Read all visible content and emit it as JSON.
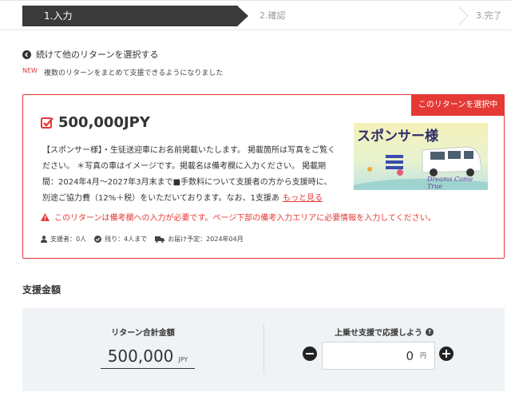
{
  "steps": {
    "step1": "1.入力",
    "step2": "2.確認",
    "step3": "3.完了"
  },
  "back_link": "続けて他のリターンを選択する",
  "notice": {
    "badge": "NEW",
    "text": "複数のリターンをまとめて支援できるようになりました"
  },
  "reward": {
    "selected_label": "このリターンを選択中",
    "price": "500,000JPY",
    "description": "【スポンサー様】・生徒送迎車にお名前掲載いたします。 掲載箇所は写真をご覧ください。 ＊写真の車はイメージです。掲載名は備考欄に入力ください。 掲載期間：2024年4月〜2027年3月末まで■手数料について支援者の方から支援時に、別途ご協力費（12%＋税）をいただいております。なお、1支援あ",
    "more_link": "もっと見る",
    "thumb_title": "スポンサー様",
    "thumb_tagline": "Dreams Come True",
    "warning": "このリターンは備考欄への入力が必要です。ページ下部の備考入力エリアに必要情報を入力してください。",
    "supporters": "支援者：0人",
    "remaining": "残り：4人まで",
    "delivery": "お届け予定：2024年04月"
  },
  "amount": {
    "section_title": "支援金額",
    "total_label": "リターン合計金額",
    "total_value": "500,000",
    "total_unit": "JPY",
    "extra_label": "上乗せ支援で応援しよう",
    "extra_value": "0",
    "extra_unit": "円"
  },
  "colors": {
    "accent": "#e53935",
    "step_active": "#3a3a3a",
    "panel_bg": "#f0f3f6"
  }
}
